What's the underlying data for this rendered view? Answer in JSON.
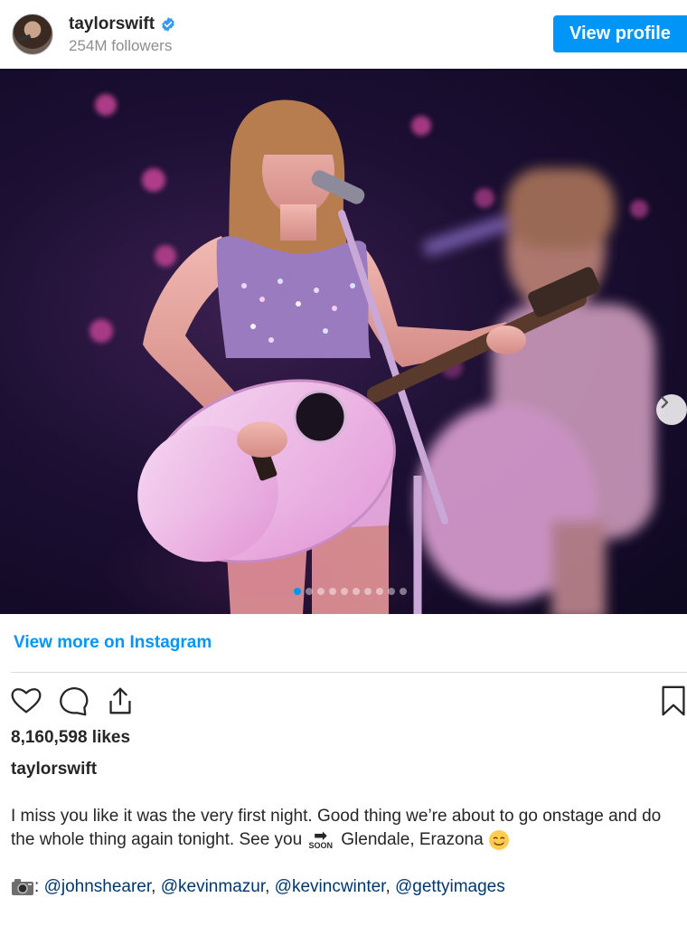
{
  "header": {
    "username": "taylorswift",
    "followers": "254M followers",
    "view_profile_label": "View profile"
  },
  "post": {
    "view_more_label": "View more on Instagram",
    "likes": "8,160,598 likes",
    "caption_user": "taylorswift",
    "caption_part1": "I miss you like it was the very first night. Good thing we’re about to go onstage and do the whole thing again tonight. See you",
    "soon_label": "SOON",
    "caption_part2": "Glendale, Erazona",
    "credits_prefix": ": ",
    "mentions": [
      "@johnshearer",
      "@kevinmazur",
      "@kevincwinter",
      "@gettyimages"
    ],
    "carousel_count": 10,
    "carousel_active_index": 0
  },
  "icons": {
    "verified": "verified-badge-icon",
    "like": "heart-icon",
    "comment": "comment-icon",
    "share": "share-icon",
    "save": "bookmark-icon",
    "next": "chevron-right-icon",
    "camera": "camera-icon",
    "smile": "smiling-face-icon"
  },
  "colors": {
    "accent": "#0095f6",
    "text": "#262626",
    "muted": "#8e8e8e",
    "mention": "#00376b"
  }
}
